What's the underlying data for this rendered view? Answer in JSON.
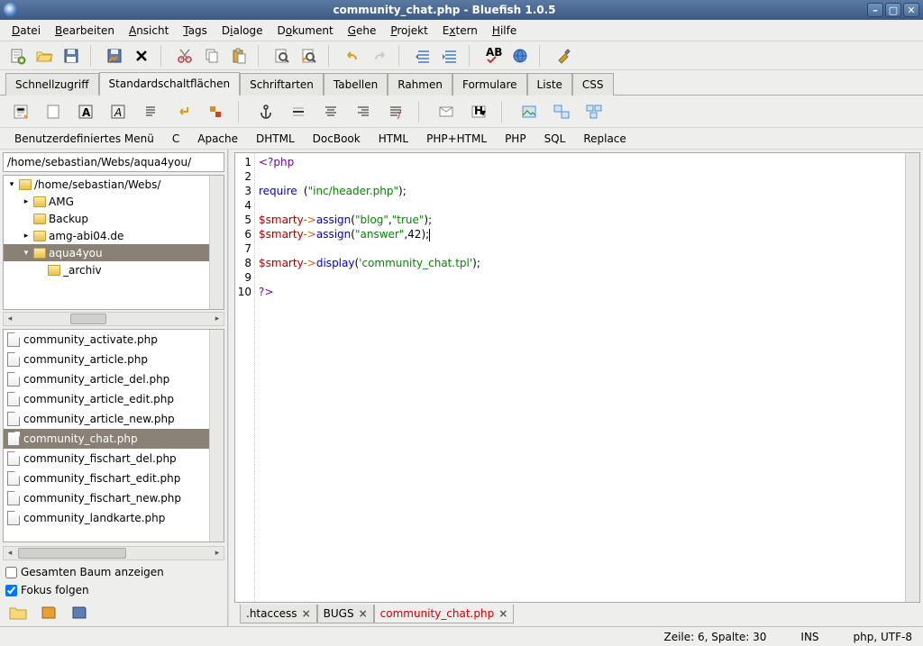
{
  "title": "community_chat.php - Bluefish 1.0.5",
  "menubar": [
    "Datei",
    "Bearbeiten",
    "Ansicht",
    "Tags",
    "Dialoge",
    "Dokument",
    "Gehe",
    "Projekt",
    "Extern",
    "Hilfe"
  ],
  "tabs1": [
    "Schnellzugriff",
    "Standardschaltflächen",
    "Schriftarten",
    "Tabellen",
    "Rahmen",
    "Formulare",
    "Liste",
    "CSS"
  ],
  "tabs1_active": 1,
  "subbar": [
    "Benutzerdefiniertes Menü",
    "C",
    "Apache",
    "DHTML",
    "DocBook",
    "HTML",
    "PHP+HTML",
    "PHP",
    "SQL",
    "Replace"
  ],
  "sidebar": {
    "path": "/home/sebastian/Webs/aqua4you/",
    "tree": [
      {
        "indent": 0,
        "exp": "▾",
        "label": "/home/sebastian/Webs/",
        "sel": false
      },
      {
        "indent": 1,
        "exp": "▸",
        "label": "AMG",
        "sel": false
      },
      {
        "indent": 1,
        "exp": "",
        "label": "Backup",
        "sel": false
      },
      {
        "indent": 1,
        "exp": "▸",
        "label": "amg-abi04.de",
        "sel": false
      },
      {
        "indent": 1,
        "exp": "▾",
        "label": "aqua4you",
        "sel": true
      },
      {
        "indent": 2,
        "exp": "",
        "label": "_archiv",
        "sel": false
      }
    ],
    "files": [
      "community_activate.php",
      "community_article.php",
      "community_article_del.php",
      "community_article_edit.php",
      "community_article_new.php",
      "community_chat.php",
      "community_fischart_del.php",
      "community_fischart_edit.php",
      "community_fischart_new.php",
      "community_landkarte.php"
    ],
    "file_selected": 5,
    "checks": [
      {
        "label": "Gesamten Baum anzeigen",
        "checked": false
      },
      {
        "label": "Fokus folgen",
        "checked": true
      }
    ]
  },
  "editor": {
    "lines": 10,
    "tabs": [
      {
        "label": ".htaccess",
        "active": false
      },
      {
        "label": "BUGS",
        "active": false
      },
      {
        "label": "community_chat.php",
        "active": true
      }
    ]
  },
  "status": {
    "pos": "Zeile: 6, Spalte: 30",
    "ins": "INS",
    "lang": "php, UTF-8"
  }
}
